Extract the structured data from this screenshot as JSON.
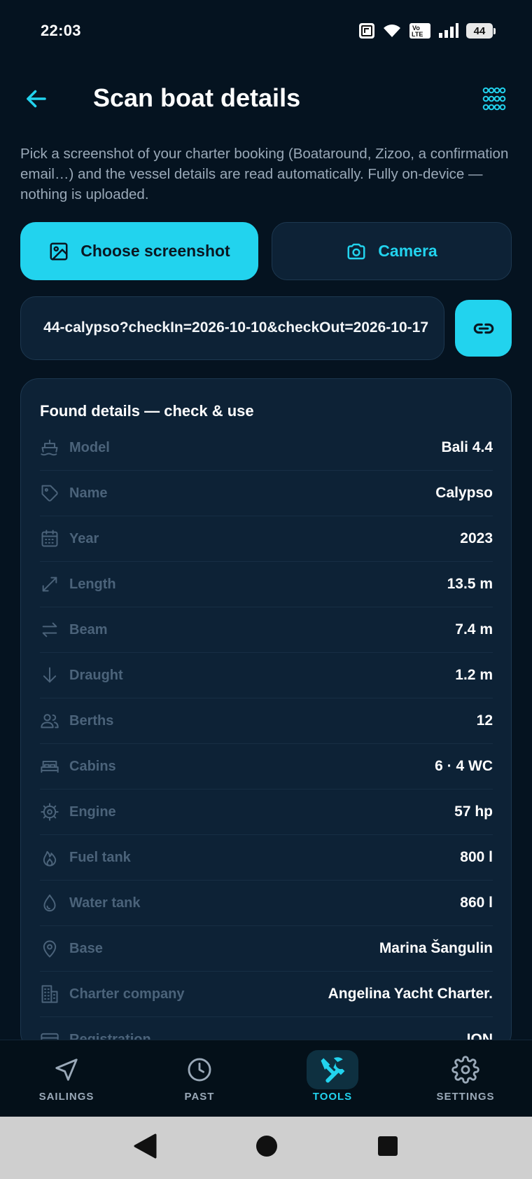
{
  "status_bar": {
    "time": "22:03",
    "battery_level": "44"
  },
  "header": {
    "title": "Scan boat details",
    "back_icon": "arrow-left-icon",
    "menu_icon": "grid-dots-icon"
  },
  "description": "Pick a screenshot of your charter booking (Boataround, Zizoo, a confirmation email…) and the vessel details are read automatically. Fully on-device — nothing is uploaded.",
  "actions": {
    "choose_screenshot_label": "Choose screenshot",
    "camera_label": "Camera"
  },
  "url_field": {
    "value": "44-calypso?checkIn=2026-10-10&checkOut=2026-10-17"
  },
  "details_card": {
    "title": "Found details — check & use",
    "rows": [
      {
        "icon": "ship-icon",
        "label": "Model",
        "value": "Bali 4.4"
      },
      {
        "icon": "tag-icon",
        "label": "Name",
        "value": "Calypso"
      },
      {
        "icon": "calendar-icon",
        "label": "Year",
        "value": "2023"
      },
      {
        "icon": "resize-diagonal-icon",
        "label": "Length",
        "value": "13.5 m"
      },
      {
        "icon": "arrows-left-right-icon",
        "label": "Beam",
        "value": "7.4 m"
      },
      {
        "icon": "arrow-down-icon",
        "label": "Draught",
        "value": "1.2 m"
      },
      {
        "icon": "users-icon",
        "label": "Berths",
        "value": "12"
      },
      {
        "icon": "bed-icon",
        "label": "Cabins",
        "value": "6 · 4 WC"
      },
      {
        "icon": "engine-gear-icon",
        "label": "Engine",
        "value": "57 hp"
      },
      {
        "icon": "flame-icon",
        "label": "Fuel tank",
        "value": "800 l"
      },
      {
        "icon": "droplet-icon",
        "label": "Water tank",
        "value": "860 l"
      },
      {
        "icon": "map-pin-icon",
        "label": "Base",
        "value": "Marina Šangulin"
      },
      {
        "icon": "building-icon",
        "label": "Charter company",
        "value": "Angelina Yacht Charter."
      },
      {
        "icon": "card-icon",
        "label": "Registration",
        "value": "ION"
      }
    ]
  },
  "bottom_nav": {
    "items": [
      {
        "label": "SAILINGS",
        "icon": "navigation-arrow-icon",
        "active": false
      },
      {
        "label": "PAST",
        "icon": "clock-icon",
        "active": false
      },
      {
        "label": "TOOLS",
        "icon": "tools-icon",
        "active": true
      },
      {
        "label": "SETTINGS",
        "icon": "gear-icon",
        "active": false
      }
    ]
  },
  "colors": {
    "background": "#051320",
    "accent": "#22d3ee",
    "card": "#0d2236",
    "muted_text": "#9aa9b8",
    "label_text": "#4b637a"
  }
}
